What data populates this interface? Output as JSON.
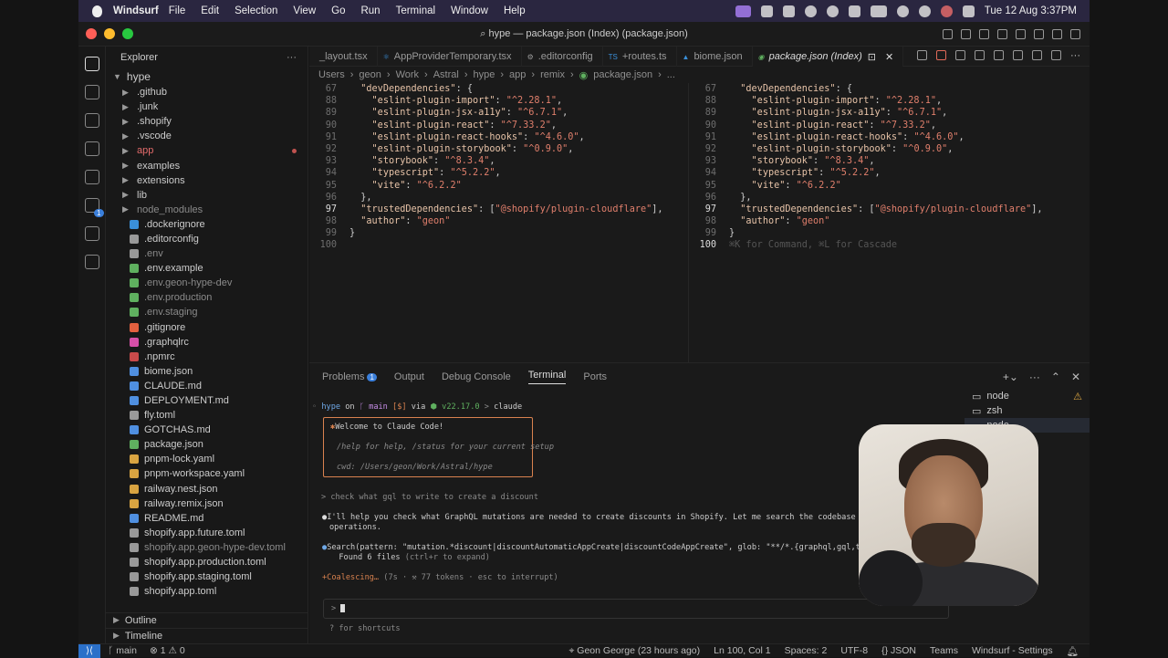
{
  "menubar": {
    "app_name": "Windsurf",
    "items": [
      "File",
      "Edit",
      "Selection",
      "View",
      "Go",
      "Run",
      "Terminal",
      "Window",
      "Help"
    ],
    "datetime": "Tue 12 Aug  3:37PM"
  },
  "window": {
    "title": "hype — package.json (Index) (package.json)"
  },
  "explorer": {
    "header": "Explorer",
    "root": "hype",
    "items": [
      {
        "name": ".github",
        "type": "folder",
        "color": "#d9a441",
        "state": "normal"
      },
      {
        "name": ".junk",
        "type": "folder",
        "color": "#d9a441",
        "state": "normal"
      },
      {
        "name": ".shopify",
        "type": "folder",
        "color": "#d9a441",
        "state": "normal"
      },
      {
        "name": ".vscode",
        "type": "folder",
        "color": "#d9a441",
        "state": "normal"
      },
      {
        "name": "app",
        "type": "folder",
        "color": "#d9a441",
        "state": "modified"
      },
      {
        "name": "examples",
        "type": "folder",
        "color": "#d9a441",
        "state": "normal"
      },
      {
        "name": "extensions",
        "type": "folder",
        "color": "#d9a441",
        "state": "normal"
      },
      {
        "name": "lib",
        "type": "folder",
        "color": "#d9a441",
        "state": "normal"
      },
      {
        "name": "node_modules",
        "type": "folder",
        "color": "#d9a441",
        "state": "dim"
      },
      {
        "name": ".dockerignore",
        "type": "file",
        "color": "#3a8fd9",
        "state": "normal"
      },
      {
        "name": ".editorconfig",
        "type": "file",
        "color": "#999999",
        "state": "normal"
      },
      {
        "name": ".env",
        "type": "file",
        "color": "#999999",
        "state": "dim"
      },
      {
        "name": ".env.example",
        "type": "file",
        "color": "#5fb05f",
        "state": "normal"
      },
      {
        "name": ".env.geon-hype-dev",
        "type": "file",
        "color": "#5fb05f",
        "state": "dim"
      },
      {
        "name": ".env.production",
        "type": "file",
        "color": "#5fb05f",
        "state": "dim"
      },
      {
        "name": ".env.staging",
        "type": "file",
        "color": "#5fb05f",
        "state": "dim"
      },
      {
        "name": ".gitignore",
        "type": "file",
        "color": "#e3603f",
        "state": "normal"
      },
      {
        "name": ".graphqlrc",
        "type": "file",
        "color": "#d64fa8",
        "state": "normal"
      },
      {
        "name": ".npmrc",
        "type": "file",
        "color": "#c94a4a",
        "state": "normal"
      },
      {
        "name": "biome.json",
        "type": "file",
        "color": "#4f8fe0",
        "state": "normal"
      },
      {
        "name": "CLAUDE.md",
        "type": "file",
        "color": "#4f8fe0",
        "state": "normal"
      },
      {
        "name": "DEPLOYMENT.md",
        "type": "file",
        "color": "#4f8fe0",
        "state": "normal"
      },
      {
        "name": "fly.toml",
        "type": "file",
        "color": "#999999",
        "state": "normal"
      },
      {
        "name": "GOTCHAS.md",
        "type": "file",
        "color": "#4f8fe0",
        "state": "normal"
      },
      {
        "name": "package.json",
        "type": "file",
        "color": "#5fb05f",
        "state": "normal"
      },
      {
        "name": "pnpm-lock.yaml",
        "type": "file",
        "color": "#d9a441",
        "state": "normal"
      },
      {
        "name": "pnpm-workspace.yaml",
        "type": "file",
        "color": "#d9a441",
        "state": "normal"
      },
      {
        "name": "railway.nest.json",
        "type": "file",
        "color": "#d9a441",
        "state": "normal"
      },
      {
        "name": "railway.remix.json",
        "type": "file",
        "color": "#d9a441",
        "state": "normal"
      },
      {
        "name": "README.md",
        "type": "file",
        "color": "#4f8fe0",
        "state": "normal"
      },
      {
        "name": "shopify.app.future.toml",
        "type": "file",
        "color": "#999999",
        "state": "normal"
      },
      {
        "name": "shopify.app.geon-hype-dev.toml",
        "type": "file",
        "color": "#999999",
        "state": "dim"
      },
      {
        "name": "shopify.app.production.toml",
        "type": "file",
        "color": "#999999",
        "state": "normal"
      },
      {
        "name": "shopify.app.staging.toml",
        "type": "file",
        "color": "#999999",
        "state": "normal"
      },
      {
        "name": "shopify.app.toml",
        "type": "file",
        "color": "#999999",
        "state": "normal"
      }
    ],
    "outline": "Outline",
    "timeline": "Timeline"
  },
  "tabs": [
    {
      "label": "_layout.tsx",
      "icon": "",
      "active": false
    },
    {
      "label": "AppProviderTemporary.tsx",
      "icon": "⚛",
      "active": false
    },
    {
      "label": ".editorconfig",
      "icon": "⚙",
      "active": false
    },
    {
      "label": "+routes.ts",
      "icon": "TS",
      "active": false
    },
    {
      "label": "biome.json",
      "icon": "▲",
      "active": false
    },
    {
      "label": "package.json (Index)",
      "icon": "◉",
      "active": true
    }
  ],
  "breadcrumb": [
    "Users",
    "geon",
    "Work",
    "Astral",
    "hype",
    "app",
    "remix",
    "package.json",
    "..."
  ],
  "code": {
    "left": [
      {
        "n": "67",
        "t": "  \"devDependencies\": {"
      },
      {
        "n": "88",
        "t": "    \"eslint-plugin-import\": \"^2.28.1\","
      },
      {
        "n": "89",
        "t": "    \"eslint-plugin-jsx-a11y\": \"^6.7.1\","
      },
      {
        "n": "90",
        "t": "    \"eslint-plugin-react\": \"^7.33.2\","
      },
      {
        "n": "91",
        "t": "    \"eslint-plugin-react-hooks\": \"^4.6.0\","
      },
      {
        "n": "92",
        "t": "    \"eslint-plugin-storybook\": \"^0.9.0\","
      },
      {
        "n": "93",
        "t": "    \"storybook\": \"^8.3.4\","
      },
      {
        "n": "94",
        "t": "    \"typescript\": \"^5.2.2\","
      },
      {
        "n": "95",
        "t": "    \"vite\": \"^6.2.2\""
      },
      {
        "n": "96",
        "t": "  },"
      },
      {
        "n": "97",
        "t": "  \"trustedDependencies\": [\"@shopify/plugin-cloudflare\"],"
      },
      {
        "n": "98",
        "t": "  \"author\": \"geon\""
      },
      {
        "n": "99",
        "t": "}"
      },
      {
        "n": "100",
        "t": ""
      }
    ],
    "right": [
      {
        "n": "67",
        "t": "  \"devDependencies\": {"
      },
      {
        "n": "88",
        "t": "    \"eslint-plugin-import\": \"^2.28.1\","
      },
      {
        "n": "89",
        "t": "    \"eslint-plugin-jsx-a11y\": \"^6.7.1\","
      },
      {
        "n": "90",
        "t": "    \"eslint-plugin-react\": \"^7.33.2\","
      },
      {
        "n": "91",
        "t": "    \"eslint-plugin-react-hooks\": \"^4.6.0\","
      },
      {
        "n": "92",
        "t": "    \"eslint-plugin-storybook\": \"^0.9.0\","
      },
      {
        "n": "93",
        "t": "    \"storybook\": \"^8.3.4\","
      },
      {
        "n": "94",
        "t": "    \"typescript\": \"^5.2.2\","
      },
      {
        "n": "95",
        "t": "    \"vite\": \"^6.2.2\""
      },
      {
        "n": "96",
        "t": "  },"
      },
      {
        "n": "97",
        "t": "  \"trustedDependencies\": [\"@shopify/plugin-cloudflare\"],"
      },
      {
        "n": "98",
        "t": "  \"author\": \"geon\""
      },
      {
        "n": "99",
        "t": "}"
      },
      {
        "n": "100",
        "t": "⌘K for Command, ⌘L for Cascade"
      }
    ]
  },
  "panel": {
    "tabs": [
      "Problems",
      "Output",
      "Debug Console",
      "Terminal",
      "Ports"
    ],
    "problems_count": "1",
    "active_tab": "Terminal"
  },
  "terminal": {
    "prompt_dir": "hype",
    "prompt_on": "on",
    "prompt_branch": "main",
    "prompt_status": "[$]",
    "prompt_via": "via",
    "prompt_node": "v22.17.0",
    "prompt_cmd": "claude",
    "welcome_title": "Welcome to Claude Code!",
    "welcome_help": "/help for help, /status for your current setup",
    "welcome_cwd": "cwd: /Users/geon/Work/Astral/hype",
    "user_msg": "> check what gql to write to create a discount",
    "reply_1": "I'll help you check what GraphQL mutations are needed to create discounts in Shopify. Let me search the codebase to find the relevant",
    "reply_2": "operations.",
    "search_call": "Search(pattern: \"mutation.*discount|discountAutomaticAppCreate|discountCodeAppCreate\", glob: \"**/*.{graphql,gql,ts,tsx}\")",
    "search_result": "  Found 6 files",
    "search_hint": "(ctrl+r to expand)",
    "status_word": "+Coalescing…",
    "status_detail": "(7s · ⚒ 77 tokens · esc to interrupt)",
    "input_prompt": ">",
    "shortcuts": "? for shortcuts"
  },
  "terminal_list": [
    "node",
    "zsh",
    "node"
  ],
  "statusbar": {
    "branch": "main",
    "errors": "1",
    "warnings": "0",
    "blame": "Geon George (23 hours ago)",
    "position": "Ln 100, Col 1",
    "spaces": "Spaces: 2",
    "encoding": "UTF-8",
    "language": "JSON",
    "teams": "Teams",
    "settings": "Windsurf - Settings"
  }
}
